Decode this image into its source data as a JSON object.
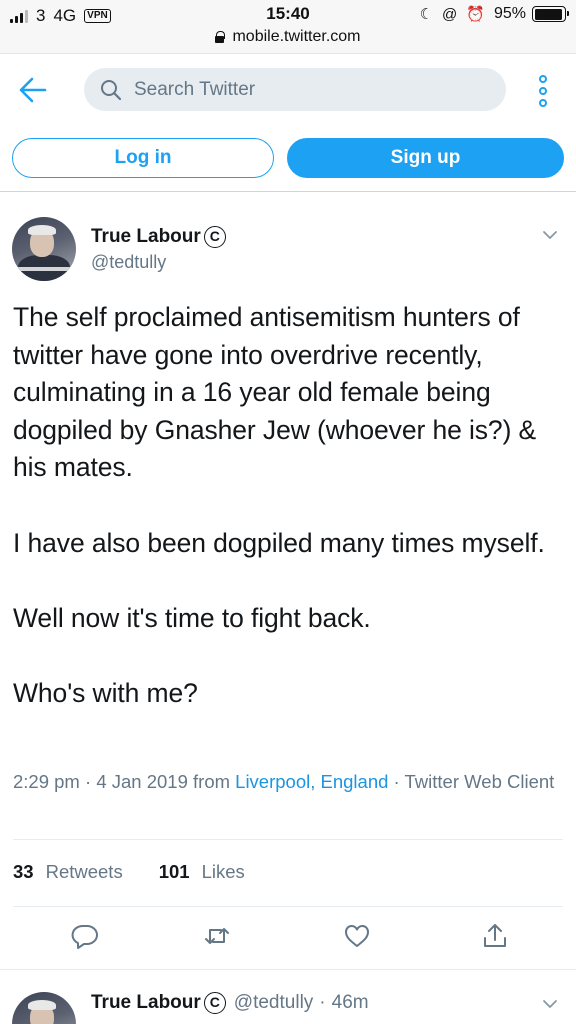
{
  "status_bar": {
    "carrier": "3",
    "network": "4G",
    "vpn": "VPN",
    "time": "15:40",
    "url": "mobile.twitter.com",
    "battery": "95%",
    "battery_level": 0.95
  },
  "header": {
    "search_placeholder": "Search Twitter"
  },
  "auth": {
    "login_label": "Log in",
    "signup_label": "Sign up"
  },
  "tweet": {
    "author_name": "True Labour",
    "author_badge": "C",
    "author_handle": "@tedtully",
    "text": "The self proclaimed antisemitism hunters of twitter have gone into overdrive recently, culminating in a 16 year old female being dogpiled by Gnasher Jew (whoever he is?) & his mates.\n\nI have also been dogpiled many times myself.\n\nWell now it's time to fight back.\n\nWho's with me?",
    "time": "2:29 pm",
    "date": "4 Jan 2019",
    "from_label": "from",
    "location": "Liverpool, England",
    "client": "Twitter Web Client",
    "separator": "·",
    "retweets_count": "33",
    "retweets_label": "Retweets",
    "likes_count": "101",
    "likes_label": "Likes"
  },
  "reply": {
    "author_name": "True Labour",
    "author_badge": "C",
    "author_handle": "@tedtully",
    "separator": "·",
    "time_ago": "46m"
  },
  "colors": {
    "accent": "#1da1f2",
    "link": "#1b95e0",
    "muted": "#657786",
    "text": "#14171a"
  },
  "icons": [
    "back-arrow-icon",
    "search-icon",
    "more-options-icon",
    "chevron-down-icon",
    "reply-icon",
    "retweet-icon",
    "like-icon",
    "share-icon",
    "lock-icon",
    "battery-icon"
  ]
}
